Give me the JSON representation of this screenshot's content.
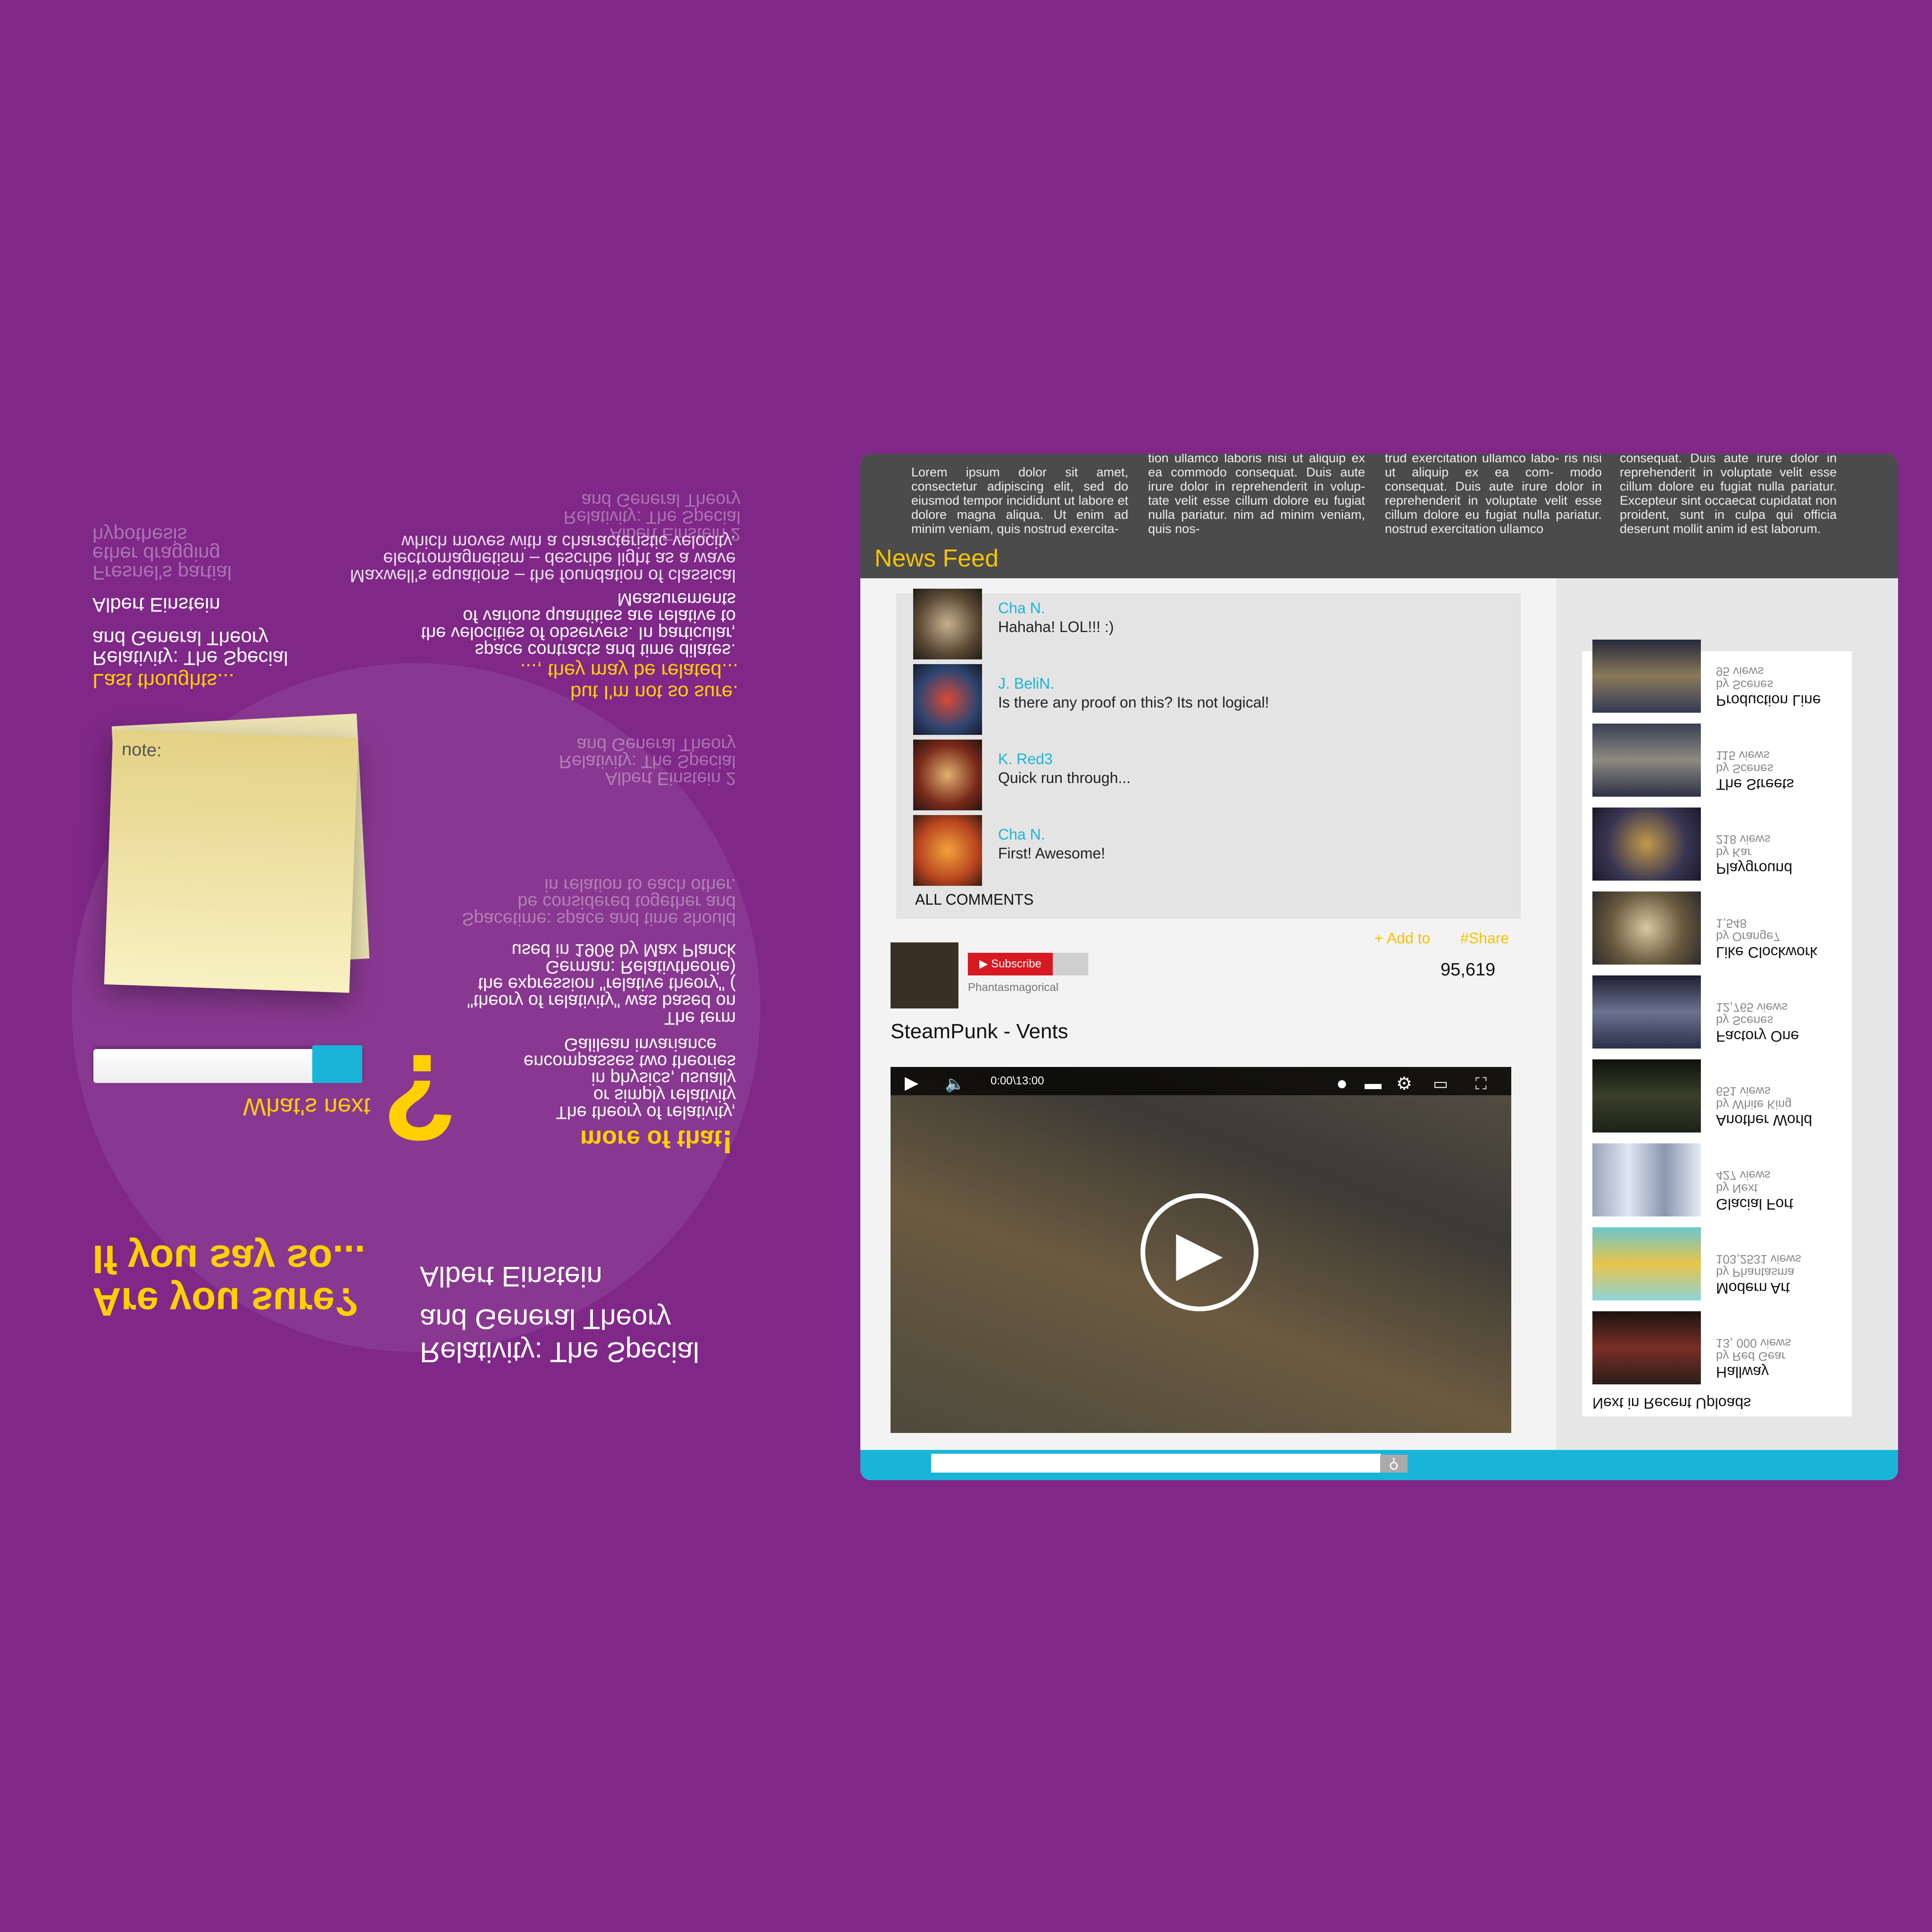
{
  "poster": {
    "headline_1": "Are you sure?",
    "headline_2": "If you say so...",
    "book_title_1": "Relativity: The Special",
    "book_title_2": "and General Theory",
    "book_author": "Albert Einstein",
    "whats_next": "What's next",
    "question_mark": "?",
    "more_of_that": "more of that",
    "search_value": "",
    "note_label": "note:",
    "para1": [
      "The theory of relativity,",
      "or simply relativity",
      "in physics, usually",
      "encompasses two theories"
    ],
    "galilean": "Galilean invariance",
    "para2": [
      "The term",
      "\"theory of relativity\" was based on",
      "the expression \"relative theory\" (",
      "German: Relativtheorie)",
      "used in 1906 by Max Planck"
    ],
    "para3": [
      "Spacetime: space and time should",
      "be considered together and",
      "in relation to each other."
    ],
    "faded_block": [
      "Albert Einstein 2",
      "Relativity: The Special",
      "and General Theory"
    ],
    "maybe_related": "..., they may be related...",
    "not_so_sure": "but I'm not so sure.",
    "para4": [
      "Measurements",
      "of various quantities are relative to",
      "the velocities of observers. In particular,",
      "space contracts and time dilates."
    ],
    "para5": [
      "Maxwell's equations – the foundation of classical",
      "electromagnetism – describe light as a wave",
      "which moves with a characteristic velocity."
    ],
    "faded_block_2": [
      "Albert Einstein 2",
      "Relativity: The Special",
      "and General Theory"
    ],
    "last_thoughts": "Last thoughts...",
    "lt_1": "Relativity: The Special",
    "lt_2": "and General Theory",
    "lt_3": "Albert Einstein",
    "lt_faded": [
      "Fresnel's partial",
      "ether dragging",
      "hypothesis"
    ]
  },
  "site": {
    "search_value": "",
    "uploads_title": "Next in Recent Uploads",
    "uploads": [
      {
        "title": "Hallway",
        "by": "by Red Gear",
        "views": "13, 000 views"
      },
      {
        "title": "Modern Art",
        "by": "by Phantasma",
        "views": "103,2531 views"
      },
      {
        "title": "Glacial Fort",
        "by": "by Next",
        "views": "427 views"
      },
      {
        "title": "Another World",
        "by": "by White King",
        "views": "651 views"
      },
      {
        "title": "Factory One",
        "by": "by Scenes",
        "views": "12,765 views"
      },
      {
        "title": "Like Clockwork",
        "by": "by Orange7",
        "views": "1,548"
      },
      {
        "title": "Playground",
        "by": "by Kar",
        "views": "218 views"
      },
      {
        "title": "The Streets",
        "by": "by Scenes",
        "views": "115 views"
      },
      {
        "title": "Production Line",
        "by": "by Scenes",
        "views": "95 views"
      }
    ],
    "video": {
      "time": "0:00\\13:00",
      "title": "SteamPunk - Vents",
      "channel": "Phantasmagorical",
      "subscribe": "Subscribe",
      "views": "95,619",
      "add_to": "+ Add to",
      "share": "#Share"
    },
    "comments_title": "ALL COMMENTS",
    "comments": [
      {
        "name": "Cha N.",
        "text": "First! Awesome!"
      },
      {
        "name": "K. Red3",
        "text": "Quick run through..."
      },
      {
        "name": "J. BeliN.",
        "text": "Is there any proof on this? Its not logical!"
      },
      {
        "name": "Cha N.",
        "text": "Hahaha! LOL!!! :)"
      }
    ],
    "newsfeed_title": "News Feed",
    "newsfeed_cols": [
      "Lorem ipsum dolor sit amet, consectetur adipiscing elit, sed do eiusmod tempor incididunt ut labore et dolore magna aliqua. Ut enim ad minim veniam, quis nostrud exercita-",
      "tion ullamco laboris nisi ut aliquip ex ea commodo consequat. Duis aute irure dolor in reprehenderit in volup- tate velit esse cillum dolore eu fugiat nulla pariatur. nim ad minim veniam, quis nos-",
      "trud exercitation ullamco labo- ris nisi ut aliquip ex ea com- modo consequat. Duis aute irure dolor in reprehenderit in voluptate velit esse cillum dolore eu fugiat nulla pariatur. nostrud exercitation ullamco",
      "laboris nisi ut aliquip ex ea commodo consequat. Duis aute irure dolor in reprehenderit in voluptate velit esse cillum dolore eu fugiat nulla pariatur. Excepteur sint occaecat cupidatat non proident, sunt in culpa qui officia deserunt mollit anim id est laborum."
    ]
  },
  "colors": {
    "background": "#7f2888",
    "accent_yellow": "#ffd000",
    "accent_cyan": "#19b5d8",
    "subscribe_red": "#d71921",
    "newsfeed_bg": "#4b4b4b"
  },
  "icons": [
    "play-icon",
    "volume-icon",
    "record-icon",
    "captions-icon",
    "settings-icon",
    "theater-icon",
    "fullscreen-icon",
    "search-icon"
  ]
}
